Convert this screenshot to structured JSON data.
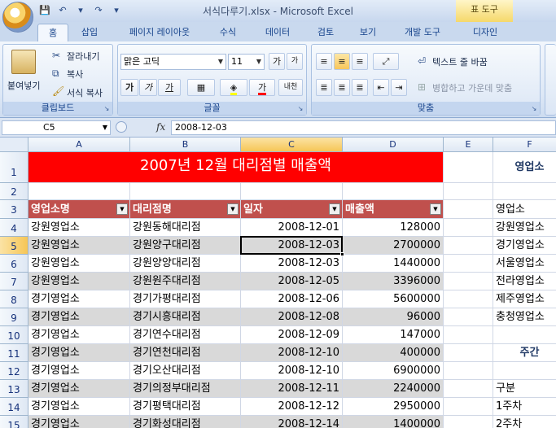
{
  "window": {
    "doc_title": "서식다루기.xlsx - Microsoft Excel",
    "context_tab_title": "표 도구"
  },
  "qat": {
    "save_icon": "💾",
    "undo_icon": "↶",
    "redo_icon": "↷",
    "more_icon": "▾"
  },
  "tabs": [
    "홈",
    "삽입",
    "페이지 레이아웃",
    "수식",
    "데이터",
    "검토",
    "보기",
    "개발 도구",
    "디자인"
  ],
  "clipboard": {
    "paste": "붙여넣기",
    "cut": "잘라내기",
    "copy": "복사",
    "format_painter": "서식 복사",
    "label": "클립보드"
  },
  "font": {
    "name": "맑은 고딕",
    "size": "11",
    "bold": "가",
    "italic": "가",
    "underline": "가",
    "grow": "가",
    "shrink": "가",
    "font_color": "가",
    "phonetic": "내천",
    "label": "글꼴"
  },
  "alignment": {
    "wrap_text": "텍스트 줄 바꿈",
    "merge_center": "병합하고 가운데 맞춤",
    "label": "맞춤"
  },
  "formula_bar": {
    "namebox": "C5",
    "fx": "fx",
    "value": "2008-12-03"
  },
  "columns": [
    "A",
    "B",
    "C",
    "D",
    "E",
    "F"
  ],
  "rows": [
    "1",
    "2",
    "3",
    "4",
    "5",
    "6",
    "7",
    "8",
    "9",
    "10",
    "11",
    "12",
    "13",
    "14",
    "15"
  ],
  "sheet": {
    "title": "2007년 12월 대리점별 매출액",
    "headers": [
      "영업소명",
      "대리점명",
      "일자",
      "매출액"
    ],
    "data": [
      [
        "강원영업소",
        "강원동해대리점",
        "2008-12-01",
        "128000"
      ],
      [
        "강원영업소",
        "강원양구대리점",
        "2008-12-03",
        "2700000"
      ],
      [
        "강원영업소",
        "강원양양대리점",
        "2008-12-03",
        "1440000"
      ],
      [
        "강원영업소",
        "강원원주대리점",
        "2008-12-05",
        "3396000"
      ],
      [
        "경기영업소",
        "경기가평대리점",
        "2008-12-06",
        "5600000"
      ],
      [
        "경기영업소",
        "경기시흥대리점",
        "2008-12-08",
        "96000"
      ],
      [
        "경기영업소",
        "경기연수대리점",
        "2008-12-09",
        "147000"
      ],
      [
        "경기영업소",
        "경기연천대리점",
        "2008-12-10",
        "400000"
      ],
      [
        "경기영업소",
        "경기오산대리점",
        "2008-12-10",
        "6900000"
      ],
      [
        "경기영업소",
        "경기의정부대리점",
        "2008-12-11",
        "2240000"
      ],
      [
        "경기영업소",
        "경기평택대리점",
        "2008-12-12",
        "2950000"
      ],
      [
        "경기영업소",
        "경기화성대리점",
        "2008-12-14",
        "1400000"
      ]
    ],
    "colF": {
      "1": "영업소",
      "3": "영업소",
      "4": "강원영업소",
      "5": "경기영업소",
      "6": "서울영업소",
      "7": "전라영업소",
      "8": "제주영업소",
      "9": "충청영업소",
      "11": "주간",
      "13": "구분",
      "14": "1주차",
      "15": "2주차"
    }
  }
}
